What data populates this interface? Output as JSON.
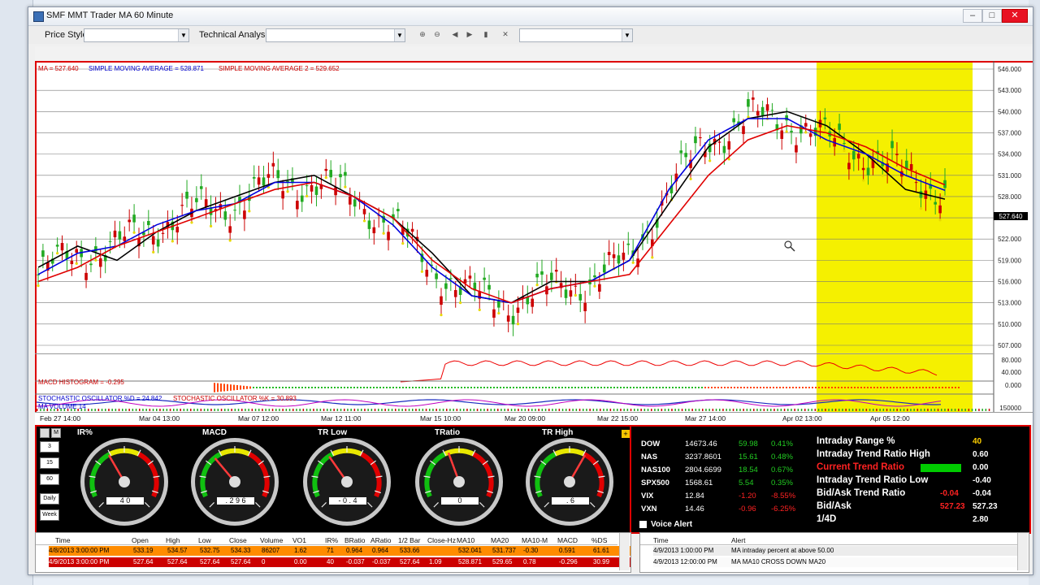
{
  "window": {
    "title": "SMF MMT Trader MA  60 Minute"
  },
  "toolbar": {
    "price_style_label": "Price Style",
    "technical_analysis_label": "Technical Analysis"
  },
  "chart": {
    "legend_ma": "MA = 527.640",
    "legend_sma1": "SIMPLE MOVING AVERAGE = 528.871",
    "legend_sma2": "SIMPLE MOVING AVERAGE 2 = 529.652",
    "macd_label": "MACD HISTOGRAM = -0.295",
    "stoch_label": "STOCHASTIC OSCILLATOR %D = 24.842",
    "stoch_label2": "STOCHASTIC OSCILLATOR %K = 30.893",
    "volume_label": "MA VOLUME 14",
    "last_price": "527.640",
    "price_ticks": [
      "546.000",
      "543.000",
      "540.000",
      "537.000",
      "534.000",
      "531.000",
      "528.000",
      "525.000",
      "522.000",
      "519.000",
      "516.000",
      "513.000",
      "510.000",
      "507.000"
    ],
    "vol_ticks": [
      "80.000",
      "40.000",
      "0.000",
      "150000"
    ],
    "date_labels": [
      "Feb 27 14:00",
      "Mar 04 13:00",
      "Mar 07 12:00",
      "Mar 12 11:00",
      "Mar 15 10:00",
      "Mar 20 09:00",
      "Mar 22 15:00",
      "Mar 27 14:00",
      "Apr 02 13:00",
      "Apr 05 12:00"
    ],
    "colors": {
      "ma": "#000000",
      "sma1": "#0000dd",
      "sma2": "#e00000",
      "highlight": "#f5f000",
      "up": "#22aa22",
      "down": "#cc0000"
    }
  },
  "chart_data": {
    "type": "line",
    "title": "",
    "series": [
      {
        "name": "MA",
        "values": [
          518,
          521,
          519,
          523,
          526,
          528,
          530,
          531,
          528,
          525,
          520,
          514,
          513,
          516,
          516,
          519,
          527,
          535,
          539,
          540,
          538,
          534,
          529,
          527.64
        ]
      },
      {
        "name": "SIMPLE MOVING AVERAGE",
        "values": [
          517,
          520,
          521,
          524,
          526,
          527,
          530,
          530,
          528,
          524,
          518,
          514,
          513,
          515,
          516,
          519,
          529,
          536,
          539,
          539,
          536,
          534,
          531,
          528.871
        ]
      },
      {
        "name": "SIMPLE MOVING AVERAGE 2",
        "values": [
          516,
          518,
          521,
          523,
          525,
          527,
          529,
          530,
          528,
          525,
          519,
          515,
          513,
          515,
          516,
          517,
          524,
          531,
          536,
          538,
          537,
          535,
          532,
          529.652
        ]
      }
    ],
    "ylim": [
      507,
      546
    ],
    "grid": true
  },
  "gauges": [
    {
      "label": "IR%",
      "value": "4 0"
    },
    {
      "label": "MACD",
      "value": ". 2 9 6"
    },
    {
      "label": "TR Low",
      "value": "- 0 . 4"
    },
    {
      "label": "TRatio",
      "value": "0"
    },
    {
      "label": "TR High",
      "value": ". 6"
    }
  ],
  "period_buttons": [
    "3",
    "15",
    "60",
    "Daily",
    "Week"
  ],
  "indices": [
    {
      "name": "DOW",
      "price": "14673.46",
      "chg": "59.98",
      "pct": "0.41%",
      "color": "#22cc22"
    },
    {
      "name": "NAS",
      "price": "3237.8601",
      "chg": "15.61",
      "pct": "0.48%",
      "color": "#22cc22"
    },
    {
      "name": "NAS100",
      "price": "2804.6699",
      "chg": "18.54",
      "pct": "0.67%",
      "color": "#22cc22"
    },
    {
      "name": "SPX500",
      "price": "1568.61",
      "chg": "5.54",
      "pct": "0.35%",
      "color": "#22cc22"
    },
    {
      "name": "VIX",
      "price": "12.84",
      "chg": "-1.20",
      "pct": "-8.55%",
      "color": "#ff2222"
    },
    {
      "name": "VXN",
      "price": "14.46",
      "chg": "-0.96",
      "pct": "-6.25%",
      "color": "#ff2222"
    }
  ],
  "voice_alert": "Voice Alert",
  "ratios": [
    {
      "label": "Intraday Range %",
      "v1": "",
      "v2": "40",
      "label_color": "#ffffff"
    },
    {
      "label": "Intraday Trend Ratio High",
      "v1": "",
      "v2": "0.60",
      "label_color": "#ffffff"
    },
    {
      "label": "Current Trend Ratio",
      "v1": "",
      "v2": "0.00",
      "label_color": "#ff2222"
    },
    {
      "label": "Intraday Trend Ratio Low",
      "v1": "",
      "v2": "-0.40",
      "label_color": "#ffffff"
    },
    {
      "label": "Bid/Ask Trend Ratio",
      "v1": "-0.04",
      "v2": "-0.04",
      "label_color": "#ffffff"
    },
    {
      "label": "Bid/Ask",
      "v1": "527.23",
      "v2": "527.23",
      "label_color": "#ffffff"
    },
    {
      "label": "1/4D",
      "v1": "",
      "v2": "2.80",
      "label_color": "#ffffff"
    }
  ],
  "table": {
    "headers": [
      "Time",
      "Open",
      "High",
      "Low",
      "Close",
      "Volume",
      "VO1",
      "IR%",
      "BRatio",
      "ARatio",
      "1/2 Bar",
      "Close-Hz",
      "MA10",
      "MA20",
      "MA10-M",
      "MACD",
      "%DS"
    ],
    "rows": [
      [
        "4/8/2013 3:00:00 PM",
        "533.19",
        "534.57",
        "532.75",
        "534.33",
        "86207",
        "1.62",
        "71",
        "0.964",
        "0.964",
        "533.66",
        "",
        "532.041",
        "531.737",
        "-0.30",
        "0.591",
        "61.61"
      ],
      [
        "4/9/2013 3:00:00 PM",
        "527.64",
        "527.64",
        "527.64",
        "527.64",
        "0",
        "0.00",
        "40",
        "-0.037",
        "-0.037",
        "527.64",
        "1.09",
        "528.871",
        "529.65",
        "0.78",
        "-0.296",
        "30.99"
      ]
    ]
  },
  "alerts": {
    "headers": [
      "Time",
      "Alert"
    ],
    "rows": [
      [
        "4/9/2013 1:00:00 PM",
        "MA intraday percent at above 50.00"
      ],
      [
        "4/9/2013 12:00:00 PM",
        "MA MA10 CROSS DOWN MA20"
      ]
    ]
  }
}
